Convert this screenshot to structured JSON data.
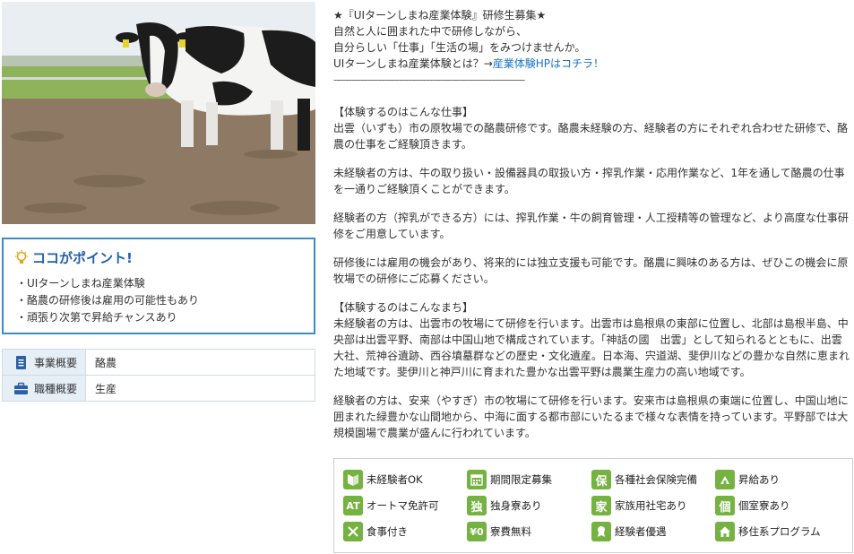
{
  "intro": {
    "line1": "★『UIターンしまね産業体験』研修生募集★",
    "line2": "自然と人に囲まれた中で研修しながら、",
    "line3": "自分らしい「仕事」「生活の場」をみつけませんか。",
    "line4_prefix": "UIターンしまね産業体験とは？→",
    "line4_link": "産業体験HPはコチラ！",
    "divider": "----------------------------------------------------------------"
  },
  "work": {
    "heading": "【体験するのはこんな仕事】",
    "p1": "出雲（いずも）市の原牧場での酪農研修です。酪農未経験の方、経験者の方にそれぞれ合わせた研修で、酪農の仕事をご経験頂きます。",
    "p2": "未経験者の方は、牛の取り扱い・設備器具の取扱い方・搾乳作業・応用作業など、1年を通して酪農の仕事を一通りご経験頂くことができます。",
    "p3": "経験者の方（搾乳ができる方）には、搾乳作業・牛の飼育管理・人工授精等の管理など、より高度な仕事研修をご用意しています。",
    "p4": "研修後には雇用の機会があり、将来的には独立支援も可能です。酪農に興味のある方は、ぜひこの機会に原牧場での研修にご応募ください。"
  },
  "town": {
    "heading": "【体験するのはこんなまち】",
    "p1": "未経験者の方は、出雲市の牧場にて研修を行います。出雲市は島根県の東部に位置し、北部は島根半島、中央部は出雲平野、南部は中国山地で構成されています。「神話の國　出雲」として知られるとともに、出雲大社、荒神谷遺跡、西谷墳墓群などの歴史・文化遺産。日本海、宍道湖、斐伊川などの豊かな自然に恵まれた地域です。斐伊川と神戸川に育まれた豊かな出雲平野は農業生産力の高い地域です。",
    "p2": "経験者の方は、安来（やすぎ）市の牧場にて研修を行います。安来市は島根県の東端に位置し、中国山地に囲まれた緑豊かな山間地から、中海に面する都市部にいたるまで様々な表情を持っています。平野部では大規模園場で農業が盛んに行われています。"
  },
  "point": {
    "title": "ココがポイント!",
    "items": [
      "UIターンしまね産業体験",
      "酪農の研修後は雇用の可能性もあり",
      "頑張り次第で昇給チャンスあり"
    ]
  },
  "info": [
    {
      "label": "事業概要",
      "value": "酪農",
      "icon": "document-icon"
    },
    {
      "label": "職種概要",
      "value": "生産",
      "icon": "briefcase-icon"
    }
  ],
  "features": [
    {
      "label": "未経験者OK",
      "glyph": "",
      "icon": "beginner-icon"
    },
    {
      "label": "期間限定募集",
      "glyph": "",
      "icon": "calendar-icon"
    },
    {
      "label": "各種社会保険完備",
      "glyph": "保",
      "icon": "insurance-icon"
    },
    {
      "label": "昇給あり",
      "glyph": "",
      "icon": "raise-icon"
    },
    {
      "label": "オートマ免許可",
      "glyph": "AT",
      "icon": "automatic-license-icon"
    },
    {
      "label": "独身寮あり",
      "glyph": "独",
      "icon": "single-dorm-icon"
    },
    {
      "label": "家族用社宅あり",
      "glyph": "家",
      "icon": "family-housing-icon"
    },
    {
      "label": "個室寮あり",
      "glyph": "個",
      "icon": "private-room-icon"
    },
    {
      "label": "食事付き",
      "glyph": "",
      "icon": "meal-icon"
    },
    {
      "label": "寮費無料",
      "glyph": "¥0",
      "icon": "free-dorm-icon"
    },
    {
      "label": "経験者優遇",
      "glyph": "",
      "icon": "experienced-icon"
    },
    {
      "label": "移住系プログラム",
      "glyph": "",
      "icon": "relocation-icon"
    }
  ],
  "colors": {
    "accent": "#3a8dc7",
    "point_title": "#1f5fae",
    "feature_green": "#75b241",
    "link": "#1a73c8"
  }
}
